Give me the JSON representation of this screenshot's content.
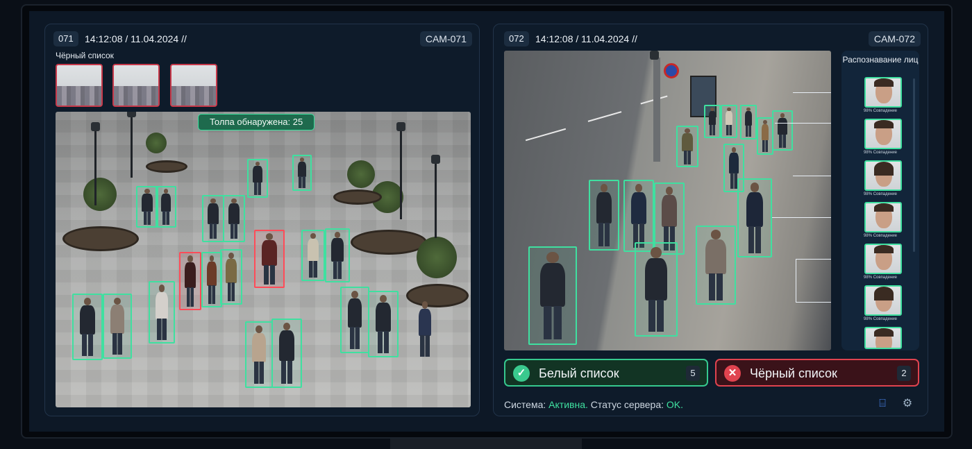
{
  "left_panel": {
    "cam_id": "071",
    "timestamp": "14:12:08 / 11.04.2024 //",
    "cam_name": "CAM-071",
    "blacklist_label": "Чёрный список",
    "crowd_label": "Толпа обнаружена: 25"
  },
  "right_panel": {
    "cam_id": "072",
    "timestamp": "14:12:08 / 11.04.2024 //",
    "cam_name": "CAM-072",
    "recognition_title": "Распознавание лиц",
    "match_label": "98% Совпадение",
    "white_list": {
      "label": "Белый список",
      "count": "5"
    },
    "black_list": {
      "label": "Чёрный список",
      "count": "2"
    },
    "status": {
      "system_label": "Система:",
      "system_value": "Активна.",
      "server_label": "Статус сервера:",
      "server_value": "OK."
    }
  },
  "colors": {
    "detect": "#3fe0a0",
    "alert": "#ff4b58",
    "panel": "#0e1b2a"
  },
  "icons": [
    "check-icon",
    "x-icon",
    "camera-icon",
    "gear-icon"
  ]
}
